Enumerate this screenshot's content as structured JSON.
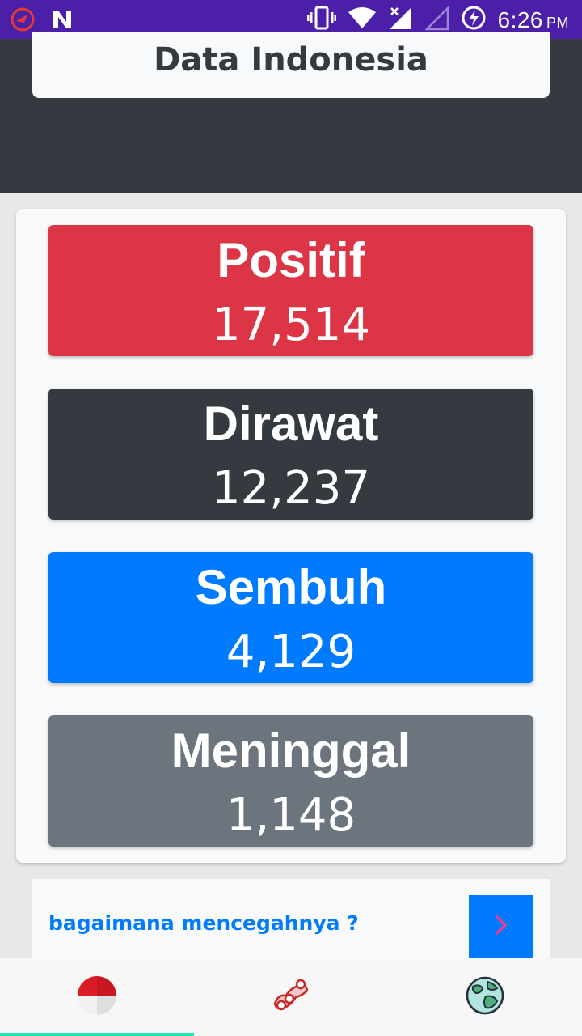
{
  "status_bar": {
    "time": "6:26",
    "ampm": "PM",
    "icons": [
      "app-notification-icon",
      "n-icon",
      "vibrate-icon",
      "wifi-icon",
      "signal-icon",
      "signal-empty-icon",
      "battery-charging-icon"
    ]
  },
  "header": {
    "title": "Data Indonesia"
  },
  "stats": [
    {
      "label": "Positif",
      "value": "17,514",
      "color": "#dc3545"
    },
    {
      "label": "Dirawat",
      "value": "12,237",
      "color": "#343a40"
    },
    {
      "label": "Sembuh",
      "value": "4,129",
      "color": "#007bff"
    },
    {
      "label": "Meninggal",
      "value": "1,148",
      "color": "#6c757d"
    }
  ],
  "prevention": {
    "text": "bagaimana mencegahnya ?",
    "button_icon": "chevron-right-icon"
  },
  "bottom_nav": {
    "items": [
      {
        "icon": "indonesia-flag-icon",
        "active": true
      },
      {
        "icon": "provinces-map-icon",
        "active": false
      },
      {
        "icon": "globe-icon",
        "active": false
      }
    ],
    "accent": "#1de9b6"
  }
}
